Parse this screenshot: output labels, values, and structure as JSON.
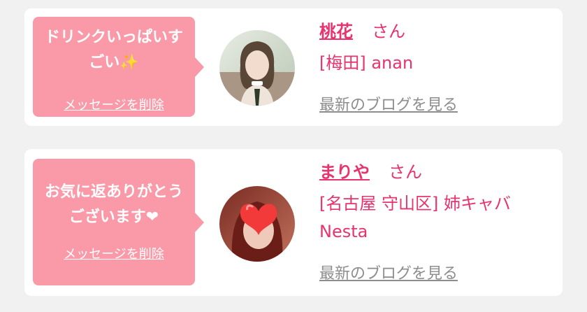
{
  "cards": [
    {
      "bubble_message": "ドリンクいっぱいすごい✨",
      "delete_label": "メッセージを削除",
      "name": "桃花",
      "honorific": "さん",
      "shop": "[梅田] anan",
      "blog_link": "最新のブログを見る"
    },
    {
      "bubble_message": "お気に返ありがとうございます❤",
      "delete_label": "メッセージを削除",
      "name": "まりや",
      "honorific": "さん",
      "shop": "[名古屋 守山区] 姉キャバNesta",
      "blog_link": "最新のブログを見る"
    }
  ],
  "colors": {
    "accent": "#e8336d",
    "bubble": "#fa9aa8",
    "link_gray": "#8d8d8d",
    "background": "#f1f1f1"
  }
}
